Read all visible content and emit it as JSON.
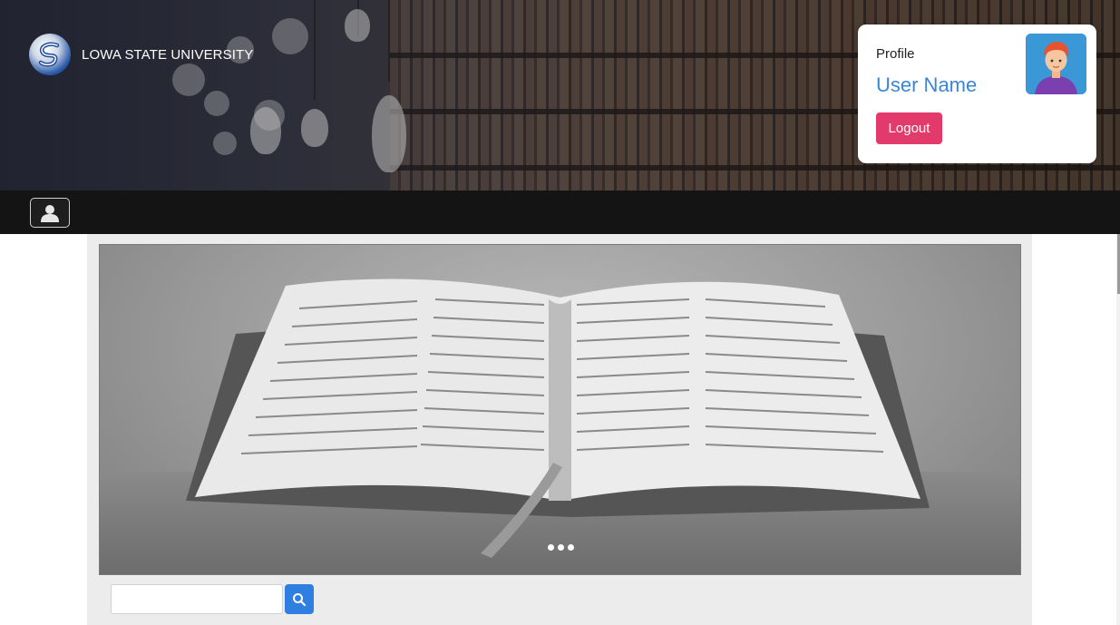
{
  "header": {
    "brand_name": "LOWA STATE UNIVERSITY",
    "logo_icon": "university-logo-icon"
  },
  "profile": {
    "label": "Profile",
    "user_name": "User Name",
    "logout_label": "Logout",
    "avatar_icon": "user-avatar-icon"
  },
  "navbar": {
    "user_button_icon": "user-icon"
  },
  "carousel": {
    "image": "open-book-image",
    "dots": 3
  },
  "search": {
    "value": "",
    "placeholder": "",
    "button_icon": "search-icon"
  },
  "colors": {
    "accent_blue": "#3a86d6",
    "logout_red": "#e23a6a",
    "search_button": "#2f7fe0",
    "navbar": "#141414"
  }
}
